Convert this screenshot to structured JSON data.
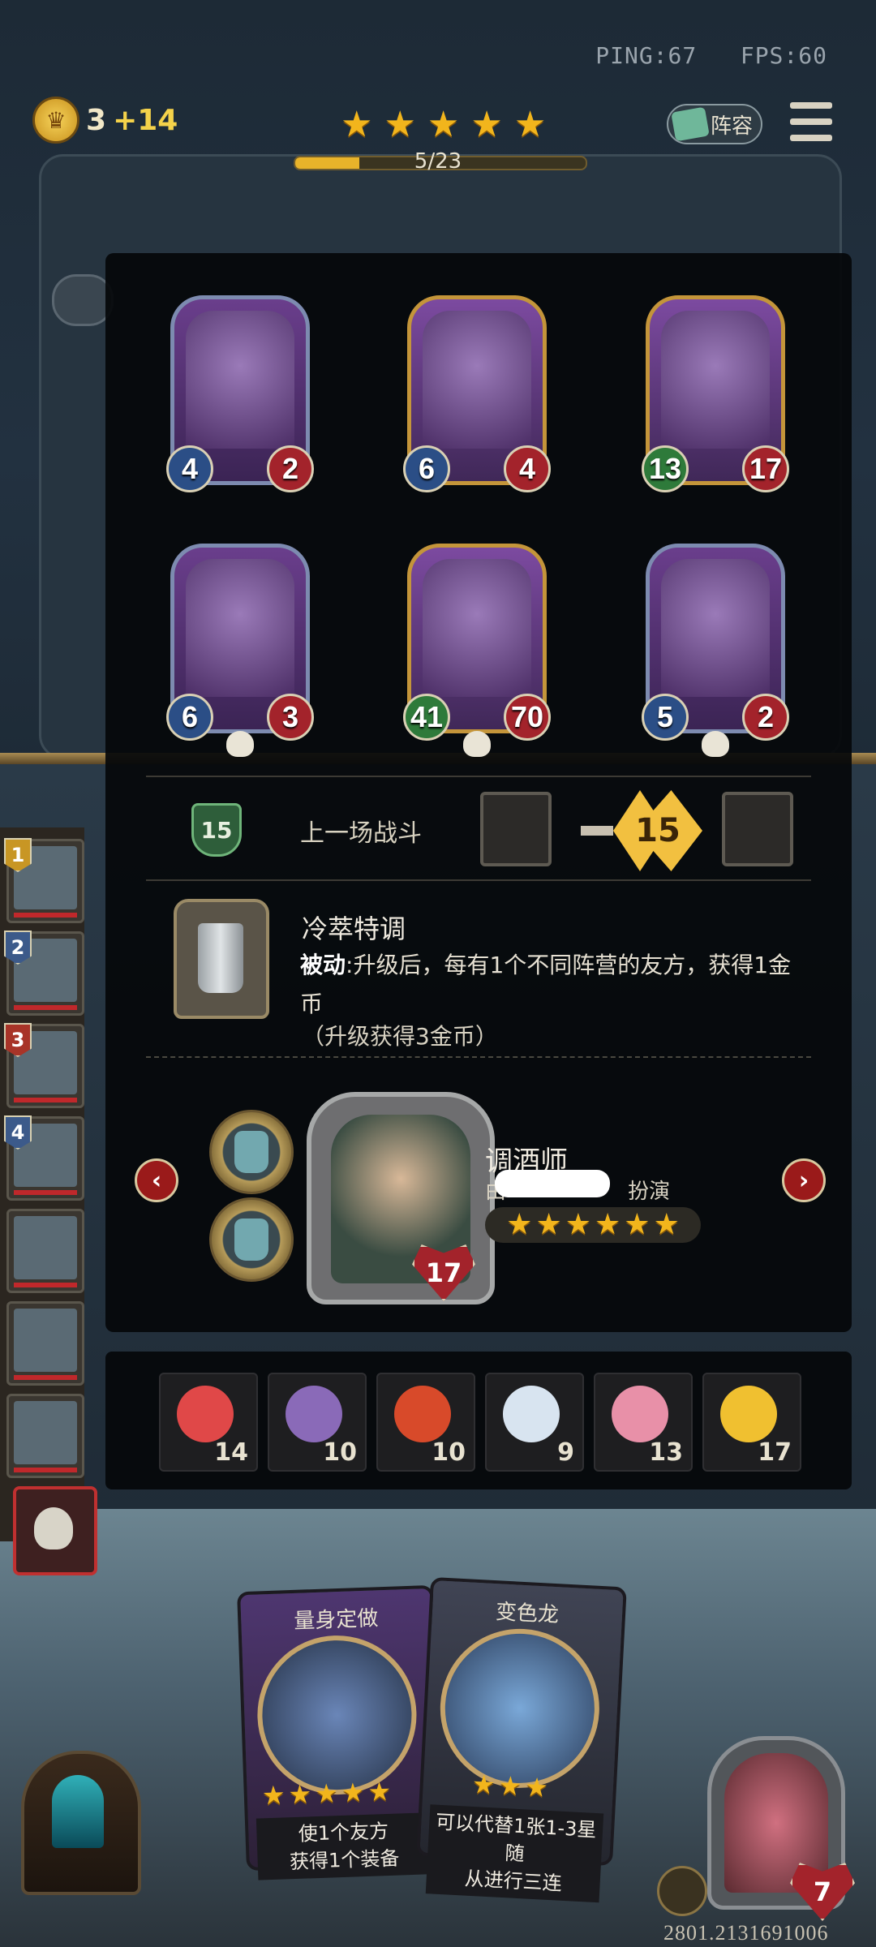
{
  "hud": {
    "ping": "PING:67",
    "fps": "FPS:60",
    "gold": "3",
    "gold_income": "+14",
    "stars": 5,
    "progress_label": "5/23",
    "progress_fraction": 0.22,
    "lineup_label": "阵容"
  },
  "offer_units": [
    {
      "name": "pink-haired-sorceress",
      "attack": "4",
      "health": "2",
      "frame": "silver",
      "attack_color": "blue"
    },
    {
      "name": "masked-rabbit",
      "attack": "6",
      "health": "4",
      "frame": "gold",
      "attack_color": "blue"
    },
    {
      "name": "horned-beetle",
      "attack": "13",
      "health": "17",
      "frame": "gold",
      "attack_color": "green"
    },
    {
      "name": "spirit-shaman",
      "attack": "6",
      "health": "3",
      "frame": "silver",
      "attack_color": "blue"
    },
    {
      "name": "green-caterpillar",
      "attack": "41",
      "health": "70",
      "frame": "gold",
      "attack_color": "green"
    },
    {
      "name": "hooded-witch",
      "attack": "5",
      "health": "2",
      "frame": "silver",
      "attack_color": "blue"
    }
  ],
  "last_battle": {
    "label": "上一场战斗",
    "level": "15",
    "damage": "15"
  },
  "ability": {
    "name": "冷萃特调",
    "desc_keyword": "被动",
    "desc_text": ":升级后，每有1个不同阵营的友方，获得1金币",
    "note": "（升级获得3金币）"
  },
  "unit": {
    "name": "调酒师",
    "credit_suffix": "扮演",
    "stars": 6,
    "health": "17",
    "prev_label": "‹",
    "next_label": "›"
  },
  "items": [
    {
      "icon": "clown-icon",
      "count": "14"
    },
    {
      "icon": "shield-card-icon",
      "count": "10"
    },
    {
      "icon": "alarm-clock-icon",
      "count": "10"
    },
    {
      "icon": "teacup-icon",
      "count": "9"
    },
    {
      "icon": "cupcake-icon",
      "count": "13"
    },
    {
      "icon": "rubber-chicken-icon",
      "count": "17"
    }
  ],
  "roster": [
    {
      "rank": "1",
      "rank_color": "gold"
    },
    {
      "rank": "2",
      "rank_color": "blue2"
    },
    {
      "rank": "3",
      "rank_color": "red"
    },
    {
      "rank": "4",
      "rank_color": "blue2"
    },
    {
      "rank": "",
      "rank_color": ""
    },
    {
      "rank": "",
      "rank_color": ""
    },
    {
      "rank": "",
      "rank_color": ""
    }
  ],
  "shop_cards": [
    {
      "title": "量身定做",
      "stars": 5,
      "desc_line1": "使1个友方",
      "desc_line2": "获得1个装备"
    },
    {
      "title": "变色龙",
      "stars": 3,
      "desc_line1": "可以代替1张1-3星随",
      "desc_line2": "从进行三连"
    }
  ],
  "hero": {
    "health": "7"
  },
  "uid": "2801.2131691006",
  "colors": {
    "star": "#f2b51c",
    "health": "#a3232b",
    "attack": "#2b4e86",
    "accent_gold": "#c4953a"
  }
}
